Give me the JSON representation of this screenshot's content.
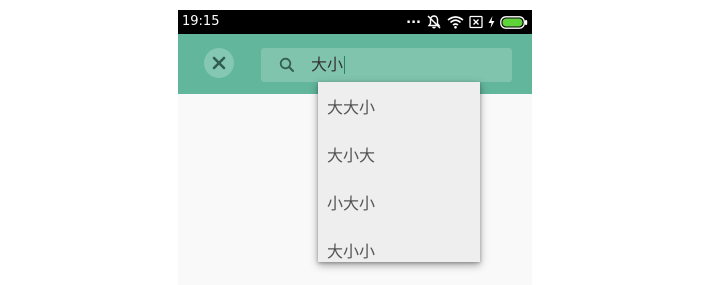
{
  "status_bar": {
    "time": "19:15",
    "dots": "...",
    "icons": [
      "mute-icon",
      "wifi-icon",
      "sim-icon",
      "charging-icon",
      "battery-icon"
    ],
    "battery_color": "#5fd33a"
  },
  "toolbar": {
    "background": "#62b69b",
    "close_icon": "close-icon"
  },
  "search": {
    "icon": "search-icon",
    "value": "大小"
  },
  "dropdown": {
    "items": [
      {
        "label": "大大小"
      },
      {
        "label": "大小大"
      },
      {
        "label": "小大小"
      },
      {
        "label": "大小小"
      }
    ]
  }
}
